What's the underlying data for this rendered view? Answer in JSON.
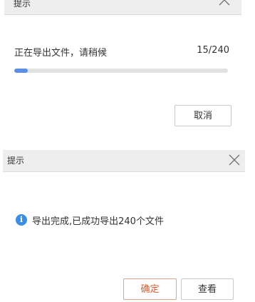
{
  "progress_dialog": {
    "title": "提示",
    "message": "正在导出文件，请稍候",
    "count_text": "15/240",
    "progress": {
      "current": 15,
      "total": 240
    },
    "cancel_label": "取消"
  },
  "complete_dialog": {
    "title": "提示",
    "message": "导出完成,已成功导出240个文件",
    "ok_label": "确定",
    "view_label": "查看"
  },
  "colors": {
    "progress_fill": "#5b8fe6",
    "info_icon": "#3a8ee6",
    "primary_text": "#e05a2b",
    "primary_border": "#e0a68d"
  },
  "icons": {
    "close": "close-icon",
    "info": "info-icon"
  }
}
